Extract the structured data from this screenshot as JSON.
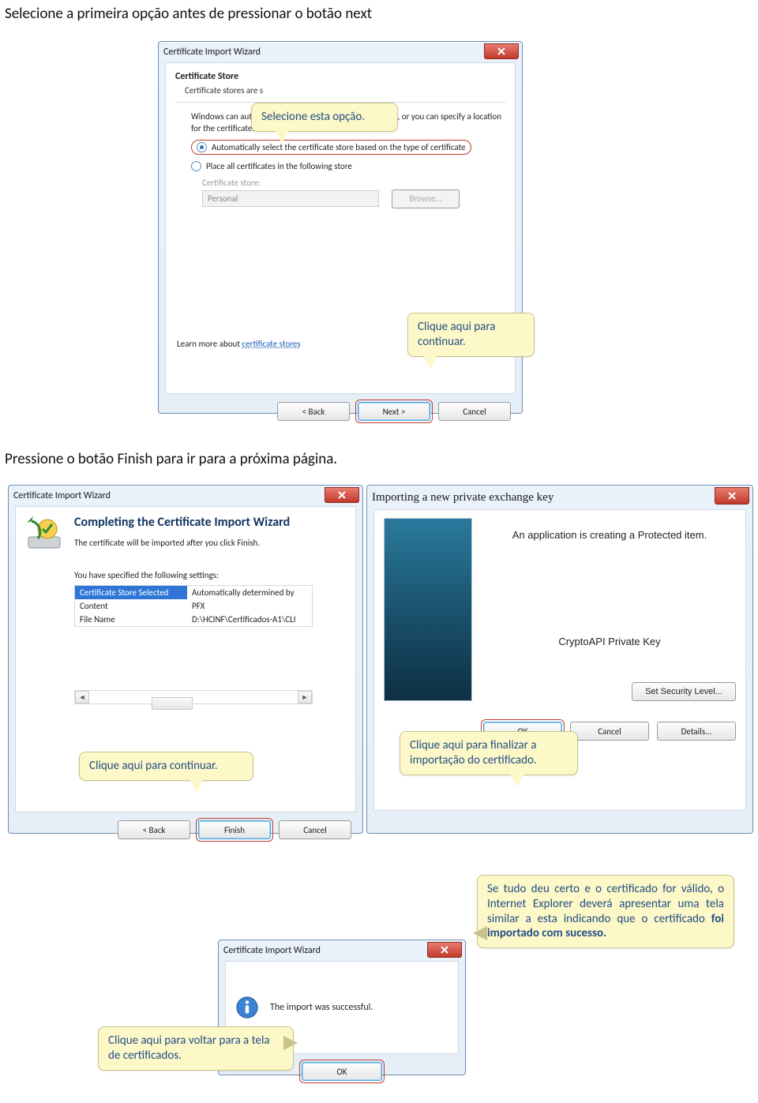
{
  "headings": {
    "h1": "Selecione a primeira opção antes de pressionar o botão next",
    "h2": "Pressione o botão Finish para ir para a próxima página."
  },
  "callouts": {
    "selectOption": "Selecione esta opção.",
    "clickContinue": "Clique aqui para continuar.",
    "clickContinue2": "Clique aqui para continuar.",
    "clickFinishImport": "Clique aqui para finalizar a importação do certificado.",
    "success_line1": "Se tudo deu certo e o certificado for válido, o Internet Explorer deverá apresentar uma tela similar a esta indicando que o certificado ",
    "success_bold1": "foi importado com sucesso.",
    "backToCerts": "Clique aqui para voltar para a tela de certificados."
  },
  "dialog1": {
    "title": "Certificate Import Wizard",
    "section": "Certificate Store",
    "sectionSub": "Certificate stores are s",
    "selectCalloutCover": "",
    "descLine1a": "Windows can automatically s",
    "descLine1b": "certificate store, or you can specify a location",
    "descLine2": "for the certificate.",
    "radio1": "Automatically select the certificate store based on the type of certificate",
    "radio2": "Place all certificates in the following store",
    "storeLabel": "Certificate store:",
    "storeValue": "Personal",
    "browse": "Browse...",
    "learnMore": "Learn more about ",
    "learnMoreLink": "certificate stores",
    "back": "< Back",
    "next": "Next >",
    "cancel": "Cancel"
  },
  "dialog2": {
    "title": "Certificate Import Wizard",
    "heading": "Completing the Certificate Import Wizard",
    "desc": "The certificate will be imported after you click Finish.",
    "settingsLabel": "You have specified the following settings:",
    "rows": [
      {
        "k": "Certificate Store Selected",
        "v": "Automatically determined by "
      },
      {
        "k": "Content",
        "v": "PFX"
      },
      {
        "k": "File Name",
        "v": "D:\\HCINF\\Certificados-A1\\CLI"
      }
    ],
    "back": "< Back",
    "finish": "Finish",
    "cancel": "Cancel"
  },
  "dialog3": {
    "title": "Importing a new private exchange key",
    "line1": "An application is creating a Protected item.",
    "line2": "CryptoAPI Private Key",
    "setSecurity": "Set Security Level...",
    "ok": "OK",
    "cancel": "Cancel",
    "details": "Details..."
  },
  "dialog4": {
    "title": "Certificate Import Wizard",
    "msg": "The import was successful.",
    "ok": "OK"
  }
}
